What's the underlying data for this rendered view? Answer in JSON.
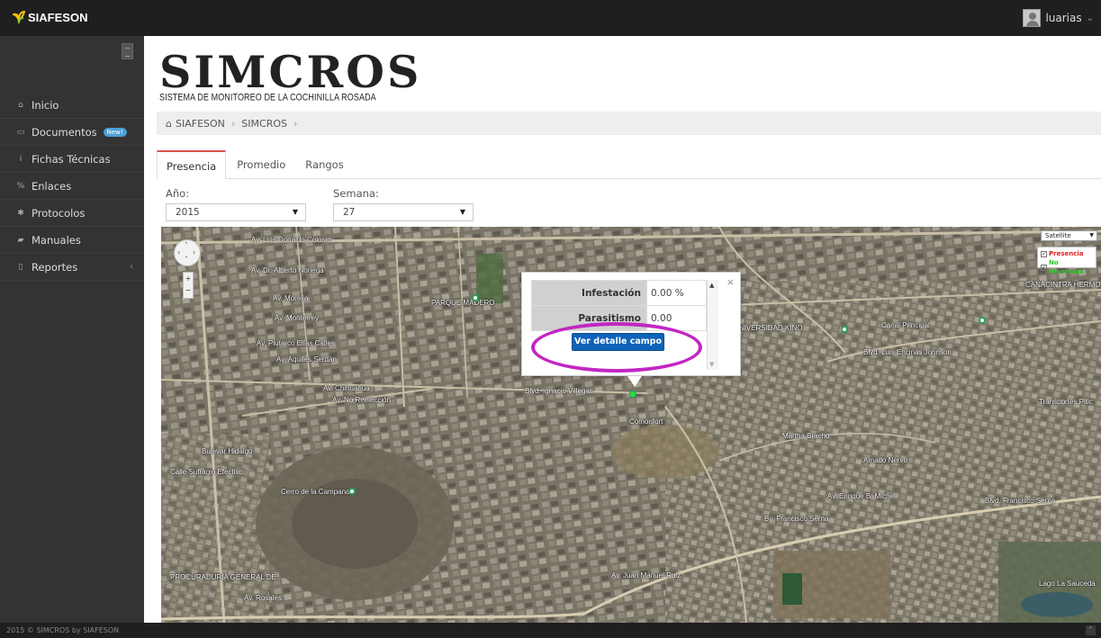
{
  "app": {
    "brand": "SIAFESON",
    "user": "luarias"
  },
  "sidebar": {
    "items": [
      {
        "label": "Inicio",
        "icon": "home-icon",
        "glyph": "⌂"
      },
      {
        "label": "Documentos",
        "icon": "folder-icon",
        "glyph": "▭",
        "badge": "New!"
      },
      {
        "label": "Fichas Técnicas",
        "icon": "info-icon",
        "glyph": "i"
      },
      {
        "label": "Enlaces",
        "icon": "link-icon",
        "glyph": "%"
      },
      {
        "label": "Protocolos",
        "icon": "gear-icon",
        "glyph": "✱"
      },
      {
        "label": "Manuales",
        "icon": "book-icon",
        "glyph": "▰"
      },
      {
        "label": "Reportes",
        "icon": "file-icon",
        "glyph": "▯"
      }
    ]
  },
  "header": {
    "title": "SIMCROS",
    "subtitle": "SISTEMA DE MONITOREO DE LA COCHINILLA ROSADA"
  },
  "breadcrumb": {
    "items": [
      "SIAFESON",
      "SIMCROS"
    ]
  },
  "tabs": [
    {
      "label": "Presencia",
      "active": true
    },
    {
      "label": "Promedio",
      "active": false
    },
    {
      "label": "Rangos",
      "active": false
    }
  ],
  "filters": {
    "year_label": "Año:",
    "year_value": "2015",
    "week_label": "Semana:",
    "week_value": "27"
  },
  "map": {
    "type_select": "Satellite",
    "legend": [
      {
        "label": "Presencia",
        "color": "#e02020",
        "checked": true
      },
      {
        "label": "No Presencia",
        "color": "#22c522",
        "checked": true
      }
    ],
    "info": {
      "rows": [
        {
          "label": "Infestación",
          "value": "0.00 %"
        },
        {
          "label": "Parasitismo",
          "value": "0.00"
        }
      ],
      "button": "Ver detalle campo"
    },
    "labels": [
      "Av. Luis Donaldo Colosio",
      "Av. Dr. Alberto Noriega",
      "Av. Morelia",
      "Av. Monterrey",
      "Av. Plutarco Elías Calles",
      "Av. Aquiles Serdán",
      "Av. Chihuahua",
      "Av. No Reelección",
      "PARQUE MADERO",
      "UNIVERSIDAD KINO",
      "Blvd. Luis Encinas Johnson",
      "Canal Principal",
      "Cerro de la Campana",
      "Blvd. Francisco Serna",
      "Bv. Francisco Serna",
      "Av. Enrique B. Michel",
      "Lago La Sauceda",
      "PROCURADURÍA GENERAL DE...",
      "Bulevar Hidalgo",
      "Av. Rosales",
      "Av. Juan Manuel Ruiz",
      "Blvd. Ignacio Villegas",
      "Calle Sufragio Efectivo",
      "CANACINTRA HERMOSILLO",
      "Martha Bracho",
      "Amado Nervo",
      "Comonfort",
      "Transportes Pitic"
    ]
  },
  "footer": {
    "text": "2015 © SIMCROS by SIAFESON"
  }
}
